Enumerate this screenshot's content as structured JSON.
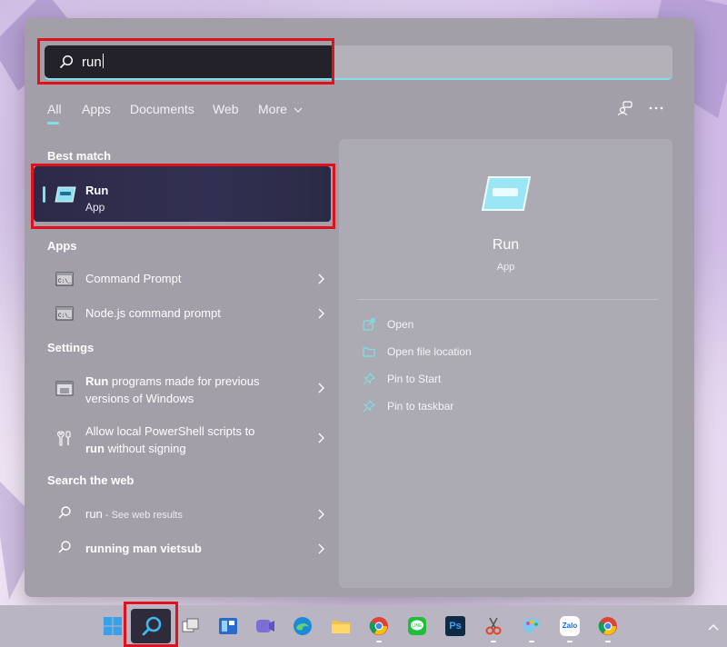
{
  "search": {
    "query": "run"
  },
  "tabs": [
    {
      "label": "All"
    },
    {
      "label": "Apps"
    },
    {
      "label": "Documents"
    },
    {
      "label": "Web"
    },
    {
      "label": "More"
    }
  ],
  "sections": {
    "best_match": "Best match",
    "apps": "Apps",
    "settings": "Settings",
    "search_web": "Search the web"
  },
  "best_match": {
    "title": "Run",
    "subtitle": "App"
  },
  "apps": [
    {
      "label": "Command Prompt",
      "icon": "cmd-icon"
    },
    {
      "label": "Node.js command prompt",
      "icon": "cmd-icon"
    }
  ],
  "settings": [
    {
      "bold": "Run",
      "line1": " programs made for previous",
      "line2": "versions of Windows",
      "icon": "compat-icon"
    },
    {
      "line1": "Allow local PowerShell scripts to",
      "bold": "run",
      "line2rest": " without signing",
      "icon": "tools-icon"
    }
  ],
  "web": [
    {
      "text": "run",
      "sub": " - See web results"
    },
    {
      "text": "running man vietsub"
    }
  ],
  "preview": {
    "title": "Run",
    "subtitle": "App",
    "actions": [
      {
        "label": "Open",
        "icon": "open-icon"
      },
      {
        "label": "Open file location",
        "icon": "folder-icon"
      },
      {
        "label": "Pin to Start",
        "icon": "pin-icon"
      },
      {
        "label": "Pin to taskbar",
        "icon": "pin-icon"
      }
    ]
  },
  "taskbar": {
    "icons": [
      "windows-icon",
      "search-icon",
      "task-view-icon",
      "widgets-icon",
      "chat-icon",
      "edge-icon",
      "file-explorer-icon",
      "chrome-icon",
      "line-icon",
      "photoshop-icon",
      "snipping-tool-icon",
      "paint-icon",
      "zalo-icon",
      "chrome-icon"
    ],
    "zalo_label": "Zalo",
    "ps_label": "Ps"
  },
  "colors": {
    "accent": "#7fe0e8",
    "highlight": "#e0101d"
  }
}
